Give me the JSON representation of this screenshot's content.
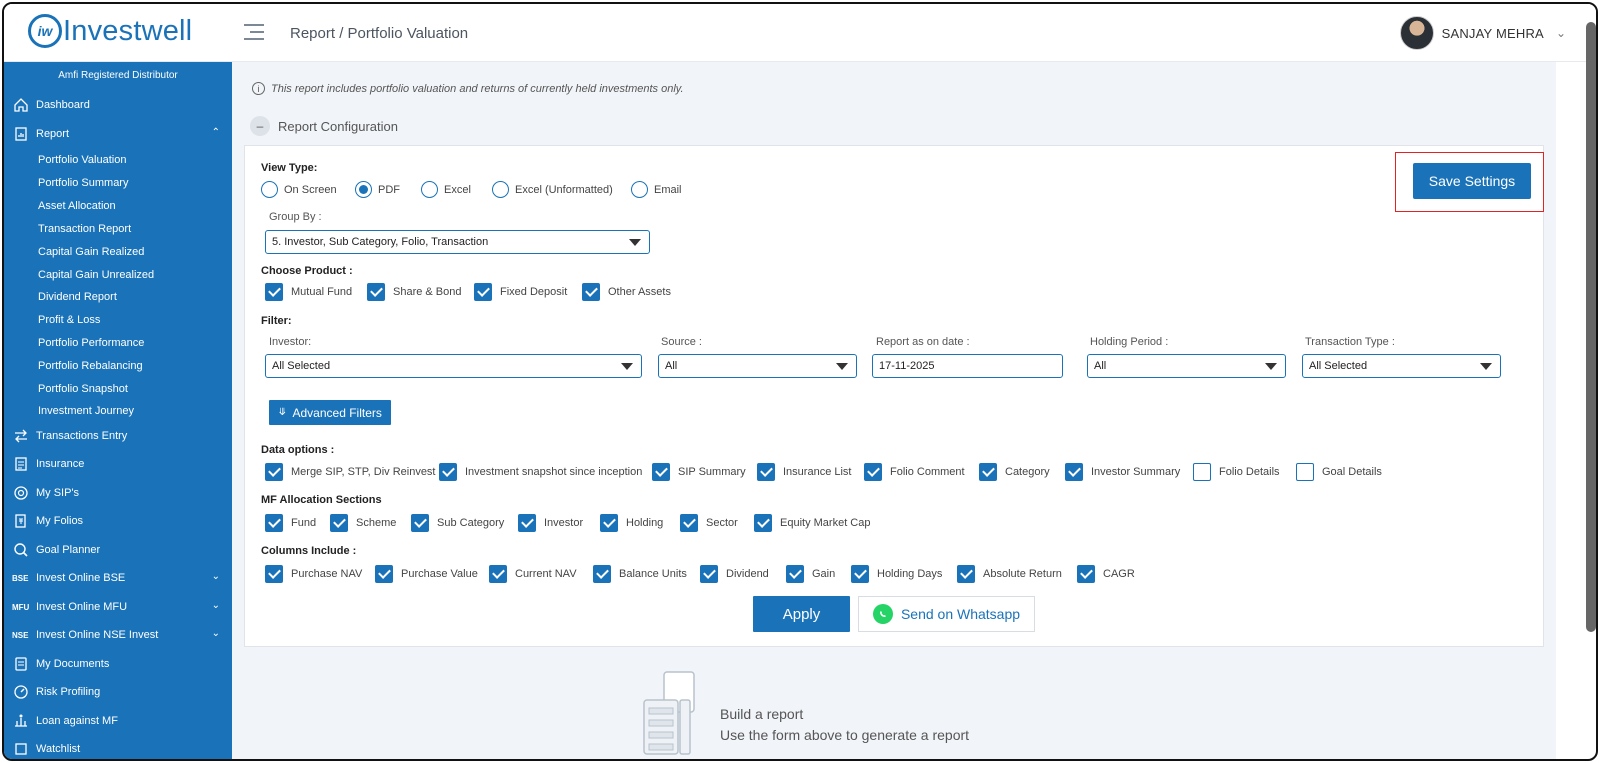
{
  "header": {
    "logo_text": "Investwell",
    "logo_mark": "iw",
    "breadcrumb": "Report / Portfolio Valuation",
    "user_name": "SANJAY MEHRA"
  },
  "sidebar": {
    "amfi": "Amfi Registered Distributor",
    "items": [
      {
        "label": "Dashboard",
        "icon": "home-icon"
      },
      {
        "label": "Report",
        "icon": "report-icon"
      },
      {
        "label": "Transactions Entry",
        "icon": "transfer-icon"
      },
      {
        "label": "Insurance",
        "icon": "document-icon"
      },
      {
        "label": "My SIP's",
        "icon": "sip-icon"
      },
      {
        "label": "My Folios",
        "icon": "folio-icon"
      },
      {
        "label": "Goal Planner",
        "icon": "goal-icon"
      },
      {
        "label": "Invest Online BSE",
        "tag": "BSE"
      },
      {
        "label": "Invest Online MFU",
        "tag": "MFU"
      },
      {
        "label": "Invest Online NSE Invest",
        "tag": "NSE"
      },
      {
        "label": "My Documents",
        "icon": "documents-icon"
      },
      {
        "label": "Risk Profiling",
        "icon": "risk-icon"
      },
      {
        "label": "Loan against MF",
        "icon": "loan-icon"
      },
      {
        "label": "Watchlist",
        "icon": "watchlist-icon"
      }
    ],
    "report_sub": [
      "Portfolio Valuation",
      "Portfolio Summary",
      "Asset Allocation",
      "Transaction Report",
      "Capital Gain Realized",
      "Capital Gain Unrealized",
      "Dividend Report",
      "Profit & Loss",
      "Portfolio Performance",
      "Portfolio Rebalancing",
      "Portfolio Snapshot",
      "Investment Journey"
    ]
  },
  "info_text": "This report includes portfolio valuation and returns of currently held investments only.",
  "report_config_label": "Report Configuration",
  "form": {
    "view_type_label": "View Type:",
    "view_types": [
      "On Screen",
      "PDF",
      "Excel",
      "Excel (Unformatted)",
      "Email"
    ],
    "view_type_selected": "PDF",
    "group_by_label": "Group By :",
    "group_by_value": "5. Investor, Sub Category, Folio, Transaction",
    "choose_product_label": "Choose Product :",
    "products": [
      {
        "label": "Mutual Fund",
        "checked": true
      },
      {
        "label": "Share & Bond",
        "checked": true
      },
      {
        "label": "Fixed Deposit",
        "checked": true
      },
      {
        "label": "Other Assets",
        "checked": true
      }
    ],
    "filter_label": "Filter:",
    "filters": [
      {
        "label": "Investor:",
        "value": "All Selected"
      },
      {
        "label": "Source :",
        "value": "All"
      },
      {
        "label": "Report as on date :",
        "value": "17-11-2025"
      },
      {
        "label": "Holding Period :",
        "value": "All"
      },
      {
        "label": "Transaction Type :",
        "value": "All Selected"
      }
    ],
    "advanced_filters_label": "Advanced Filters",
    "data_options_label": "Data options :",
    "data_options": [
      {
        "label": "Merge SIP, STP, Div Reinvest",
        "checked": true
      },
      {
        "label": "Investment snapshot since inception",
        "checked": true
      },
      {
        "label": "SIP Summary",
        "checked": true
      },
      {
        "label": "Insurance List",
        "checked": true
      },
      {
        "label": "Folio Comment",
        "checked": true
      },
      {
        "label": "Category",
        "checked": true
      },
      {
        "label": "Investor Summary",
        "checked": true
      },
      {
        "label": "Folio Details",
        "checked": false
      },
      {
        "label": "Goal Details",
        "checked": false
      }
    ],
    "mf_allocation_label": "MF Allocation Sections",
    "mf_allocation": [
      {
        "label": "Fund",
        "checked": true
      },
      {
        "label": "Scheme",
        "checked": true
      },
      {
        "label": "Sub Category",
        "checked": true
      },
      {
        "label": "Investor",
        "checked": true
      },
      {
        "label": "Holding",
        "checked": true
      },
      {
        "label": "Sector",
        "checked": true
      },
      {
        "label": "Equity Market Cap",
        "checked": true
      }
    ],
    "columns_label": "Columns Include :",
    "columns": [
      {
        "label": "Purchase NAV",
        "checked": true
      },
      {
        "label": "Purchase Value",
        "checked": true
      },
      {
        "label": "Current NAV",
        "checked": true
      },
      {
        "label": "Balance Units",
        "checked": true
      },
      {
        "label": "Dividend",
        "checked": true
      },
      {
        "label": "Gain",
        "checked": true
      },
      {
        "label": "Holding Days",
        "checked": true
      },
      {
        "label": "Absolute Return",
        "checked": true
      },
      {
        "label": "CAGR",
        "checked": true
      }
    ],
    "save_settings_label": "Save Settings",
    "apply_label": "Apply",
    "whatsapp_label": "Send on Whatsapp"
  },
  "empty_state": {
    "title": "Build a report",
    "subtitle": "Use the form above to generate a report"
  },
  "colors": {
    "primary": "#1a73b8",
    "highlight": "#e02424",
    "whatsapp": "#25d366"
  }
}
